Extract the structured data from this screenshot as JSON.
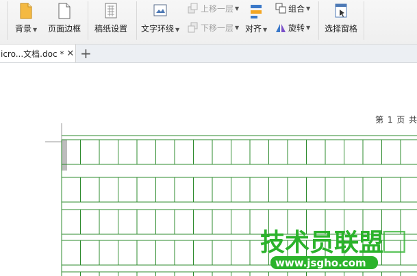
{
  "ribbon": {
    "background_label": "背景",
    "page_border_label": "页面边框",
    "manuscript_label": "稿纸设置",
    "text_wrap_label": "文字环绕",
    "bring_forward_label": "上移一层",
    "send_backward_label": "下移一层",
    "align_label": "对齐",
    "group_label": "组合",
    "rotate_label": "旋转",
    "selection_pane_label": "选择窗格"
  },
  "tabs": {
    "doc_title": "icro...文档.doc *",
    "close_symbol": "✕",
    "add_symbol": "+"
  },
  "document": {
    "page_info": "第 1 页 共"
  },
  "watermark": {
    "title": "技术员联盟",
    "url": "www.jsgho.com"
  },
  "colors": {
    "grid_green": "#2e8b2e",
    "watermark_green": "#2bb32b"
  }
}
